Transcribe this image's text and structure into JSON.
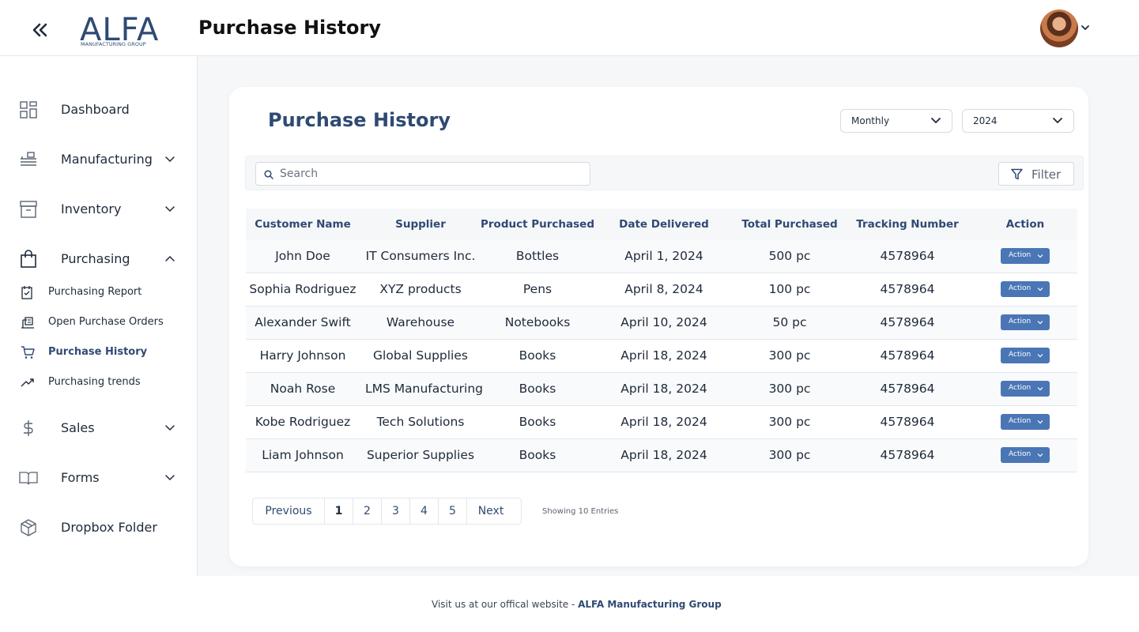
{
  "header": {
    "title": "Purchase History",
    "logo_text": "ALFA",
    "logo_subtext": "MANUFACTURING GROUP"
  },
  "sidebar": {
    "items": [
      {
        "label": "Dashboard",
        "icon": "dashboard-icon"
      },
      {
        "label": "Manufacturing",
        "icon": "manufacturing-icon"
      },
      {
        "label": "Inventory",
        "icon": "inventory-icon"
      },
      {
        "label": "Purchasing",
        "icon": "shopping-bag-icon"
      },
      {
        "label": "Sales",
        "icon": "dollar-icon"
      },
      {
        "label": "Forms",
        "icon": "book-icon"
      },
      {
        "label": "Dropbox Folder",
        "icon": "box-icon"
      }
    ],
    "purchasing_sub": [
      {
        "label": "Purchasing Report",
        "icon": "report-icon"
      },
      {
        "label": "Open Purchase Orders",
        "icon": "orders-icon"
      },
      {
        "label": "Purchase History",
        "icon": "cart-icon",
        "active": true
      },
      {
        "label": "Purchasing trends",
        "icon": "trend-icon"
      }
    ]
  },
  "main": {
    "title": "Purchase History",
    "period_select": "Monthly",
    "year_select": "2024",
    "search_placeholder": "Search",
    "filter_label": "Filter",
    "columns": [
      "Customer Name",
      "Supplier",
      "Product Purchased",
      "Date Delivered",
      "Total Purchased",
      "Tracking Number",
      "Action"
    ],
    "rows": [
      [
        "John Doe",
        "IT Consumers Inc.",
        "Bottles",
        "April 1, 2024",
        "500 pc",
        "4578964"
      ],
      [
        "Sophia Rodriguez",
        "XYZ products",
        "Pens",
        "April 8, 2024",
        "100 pc",
        "4578964"
      ],
      [
        "Alexander Swift",
        "Warehouse",
        "Notebooks",
        "April 10, 2024",
        "50 pc",
        "4578964"
      ],
      [
        "Harry Johnson",
        "Global Supplies",
        "Books",
        "April 18, 2024",
        "300 pc",
        "4578964"
      ],
      [
        "Noah Rose",
        "LMS Manufacturing",
        "Books",
        "April 18, 2024",
        "300 pc",
        "4578964"
      ],
      [
        "Kobe Rodriguez",
        "Tech Solutions",
        "Books",
        "April 18, 2024",
        "300 pc",
        "4578964"
      ],
      [
        "Liam Johnson",
        "Superior Supplies",
        "Books",
        "April 18, 2024",
        "300 pc",
        "4578964"
      ]
    ],
    "action_label": "Action",
    "pagination": {
      "previous": "Previous",
      "pages": [
        "1",
        "2",
        "3",
        "4",
        "5"
      ],
      "current": "1",
      "next": "Next",
      "entries_text": "Showing 10 Entries"
    }
  },
  "footer": {
    "text": "Visit us at our offical website - ",
    "link": "ALFA Manufacturing Group"
  },
  "colors": {
    "accent": "#2f4a73",
    "action_button": "#4a76b6"
  }
}
